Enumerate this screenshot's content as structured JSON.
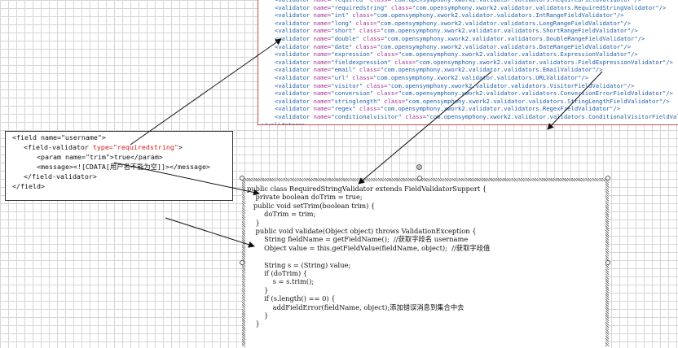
{
  "validators": {
    "lines": [
      {
        "name": "\"required\"",
        "cls": "\"com.opensymphony.xwork2.validator.validators.RequiredFieldValidator\"/>"
      },
      {
        "name": "\"requiredstring\"",
        "cls": "\"com.opensymphony.xwork2.validator.validators.RequiredStringValidator\"/>"
      },
      {
        "name": "\"int\"",
        "cls": "\"com.opensymphony.xwork2.validator.validators.IntRangeFieldValidator\"/>"
      },
      {
        "name": "\"long\"",
        "cls": "\"com.opensymphony.xwork2.validator.validators.LongRangeFieldValidator\"/>"
      },
      {
        "name": "\"short\"",
        "cls": "\"com.opensymphony.xwork2.validator.validators.ShortRangeFieldValidator\"/>"
      },
      {
        "name": "\"double\"",
        "cls": "\"com.opensymphony.xwork2.validator.validators.DoubleRangeFieldValidator\"/>"
      },
      {
        "name": "\"date\"",
        "cls": "\"com.opensymphony.xwork2.validator.validators.DateRangeFieldValidator\"/>"
      },
      {
        "name": "\"expression\"",
        "cls": "\"com.opensymphony.xwork2.validator.validators.ExpressionValidator\"/>"
      },
      {
        "name": "\"fieldexpression\"",
        "cls": "\"com.opensymphony.xwork2.validator.validators.FieldExpressionValidator\"/>"
      },
      {
        "name": "\"email\"",
        "cls": "\"com.opensymphony.xwork2.validator.validators.EmailValidator\"/>"
      },
      {
        "name": "\"url\"",
        "cls": "\"com.opensymphony.xwork2.validator.validators.URLValidator\"/>"
      },
      {
        "name": "\"visitor\"",
        "cls": "\"com.opensymphony.xwork2.validator.validators.VisitorFieldValidator\"/>"
      },
      {
        "name": "\"conversion\"",
        "cls": "\"com.opensymphony.xwork2.validator.validators.ConversionErrorFieldValidator\"/>"
      },
      {
        "name": "\"stringlength\"",
        "cls": "\"com.opensymphony.xwork2.validator.validators.StringLengthFieldValidator\"/>"
      },
      {
        "name": "\"regex\"",
        "cls": "\"com.opensymphony.xwork2.validator.validators.RegexFieldValidator\"/>"
      },
      {
        "name": "\"conditionalvisitor\"",
        "cls": "\"com.opensymphony.xwork2.validator.validators.ConditionalVisitorFieldValidator\"/>"
      }
    ],
    "tag_open": "<validator",
    "name_attr": "name=",
    "class_attr": "class=",
    "closing": "</validators>"
  },
  "xml": {
    "l1": "<field name=\"username\">",
    "l2a": "<field-validator ",
    "l2b": "type=\"requiredstring\"",
    "l2c": ">",
    "l3": "<param name=\"trim\">true</param>",
    "l4": "<message><![CDATA[用户名不能为空]]></message>",
    "l5": "</field-validator>",
    "l6": "</field>"
  },
  "code": {
    "lines": [
      "public class RequiredStringValidator extends FieldValidatorSupport {",
      "    private boolean doTrim = true;",
      "   public void setTrim(boolean trim) {",
      "        doTrim = trim;",
      "    }",
      "    public void validate(Object object) throws ValidationException {",
      "        String fieldName = getFieldName();  //获取字段名 username",
      "        Object value = this.getFieldValue(fieldName, object);  //获取字段值",
      "",
      "        String s = (String) value;",
      "        if (doTrim) {",
      "            s = s.trim();",
      "        }",
      "        if (s.length() == 0) {",
      "            addFieldError(fieldName, object);添加错误消息到集合中去",
      "        }",
      "    }"
    ]
  }
}
